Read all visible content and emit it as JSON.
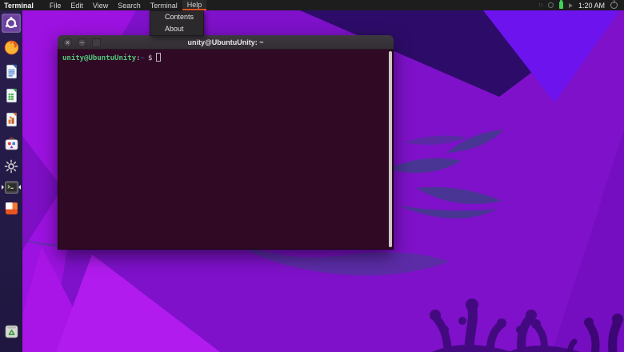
{
  "topbar": {
    "app_name": "Terminal",
    "menus": [
      {
        "label": "File"
      },
      {
        "label": "Edit"
      },
      {
        "label": "View"
      },
      {
        "label": "Search"
      },
      {
        "label": "Terminal"
      },
      {
        "label": "Help"
      }
    ],
    "active_menu": "Help",
    "clock": "1:20 AM",
    "status_icons": [
      "network-icon",
      "keyboard-indicator-icon",
      "battery-icon",
      "volume-icon",
      "power-icon"
    ]
  },
  "help_menu": {
    "items": [
      {
        "label": "Contents"
      },
      {
        "label": "About"
      }
    ]
  },
  "launcher": {
    "items": [
      "ubuntu-logo-icon",
      "firefox-icon",
      "libreoffice-writer-icon",
      "libreoffice-calc-icon",
      "libreoffice-impress-icon",
      "software-center-icon",
      "settings-gear-icon",
      "terminal-icon",
      "software-updater-icon",
      "trash-icon"
    ],
    "running_app": "terminal"
  },
  "window": {
    "title": "unity@UbuntuUnity: ~",
    "controls": {
      "close": "×",
      "minimize": "−",
      "maximize": ""
    },
    "terminal": {
      "prompt_user_host": "unity@UbuntuUnity",
      "prompt_separator": ":",
      "prompt_path": "~",
      "prompt_symbol": "$"
    }
  },
  "colors": {
    "accent_orange": "#E95420",
    "terminal_background": "#300A24",
    "prompt_green": "#4FC87C",
    "battery_green": "#3FD158",
    "wallpaper_base": "#7E11C9",
    "wallpaper_violet_triangle": "#6C13EE",
    "wallpaper_dark_indigo": "#2D0C69"
  }
}
